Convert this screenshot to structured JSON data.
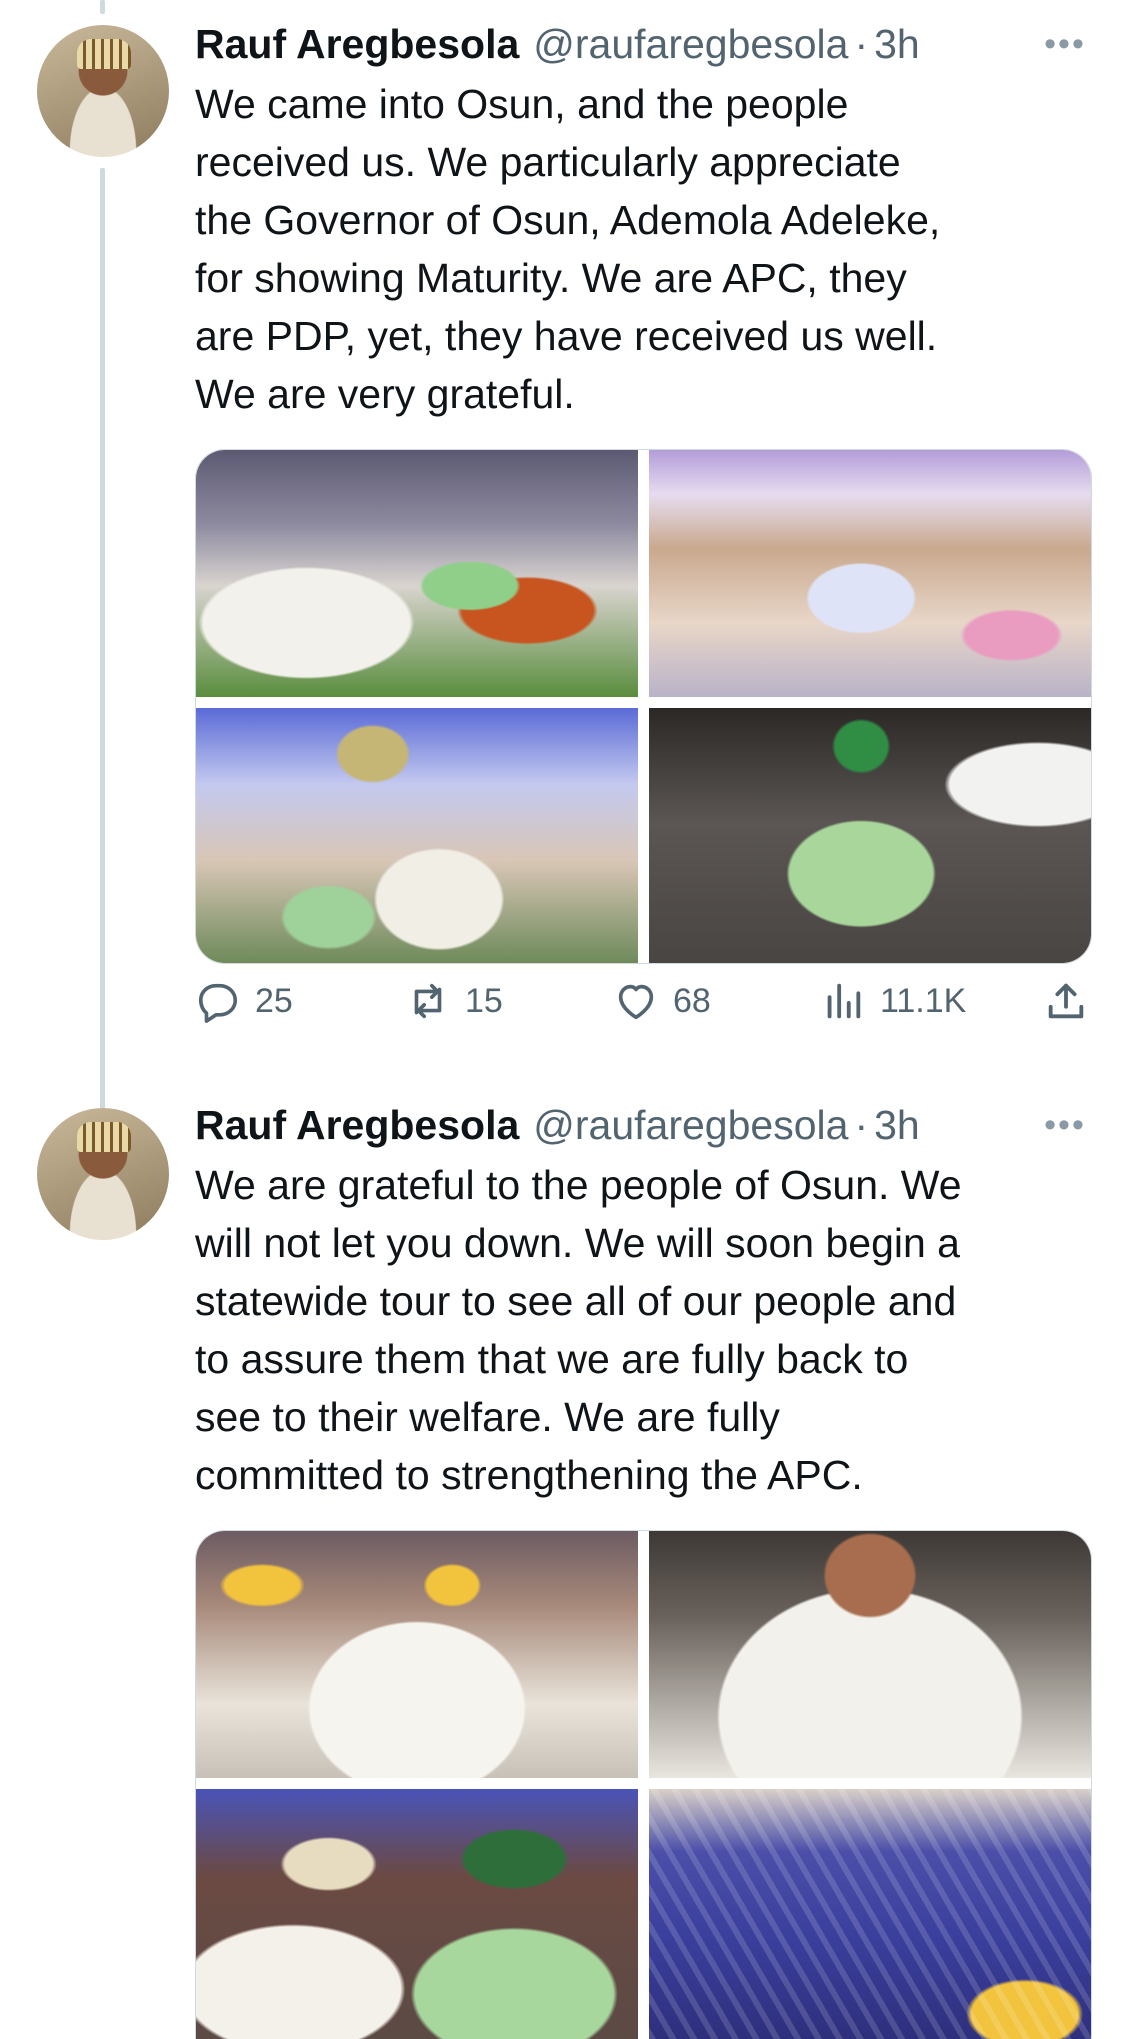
{
  "tweets": [
    {
      "author_name": "Rauf Aregbesola",
      "handle": "@raufaregbesola",
      "separator": "·",
      "time": "3h",
      "more": "•••",
      "text_lines": [
        "We came into Osun, and the people",
        "received us. We particularly appreciate",
        "the Governor of Osun, Ademola Adeleke,",
        "for showing Maturity. We are APC, they",
        "are PDP, yet, they have received us well.",
        "We are very grateful."
      ],
      "actions": {
        "reply_count": "25",
        "retweet_count": "15",
        "like_count": "68",
        "views_count": "11.1K"
      }
    },
    {
      "author_name": "Rauf Aregbesola",
      "handle": "@raufaregbesola",
      "separator": "·",
      "time": "3h",
      "more": "•••",
      "text_lines": [
        "We are grateful to the people of Osun. We",
        "will not let you down. We will soon begin a",
        "statewide tour to see all of our people and",
        "to assure them that we are fully back to",
        "see to their welfare. We are fully",
        "committed to strengthening the APC."
      ]
    }
  ],
  "icons": {
    "reply": "speech-bubble-icon",
    "retweet": "retweet-arrows-icon",
    "like": "heart-icon",
    "views": "bar-chart-icon",
    "share": "share-upload-icon"
  },
  "colors": {
    "text": "#0f1419",
    "secondary": "#536471",
    "thread_line": "#cfd9de",
    "border": "#cfd9de"
  }
}
